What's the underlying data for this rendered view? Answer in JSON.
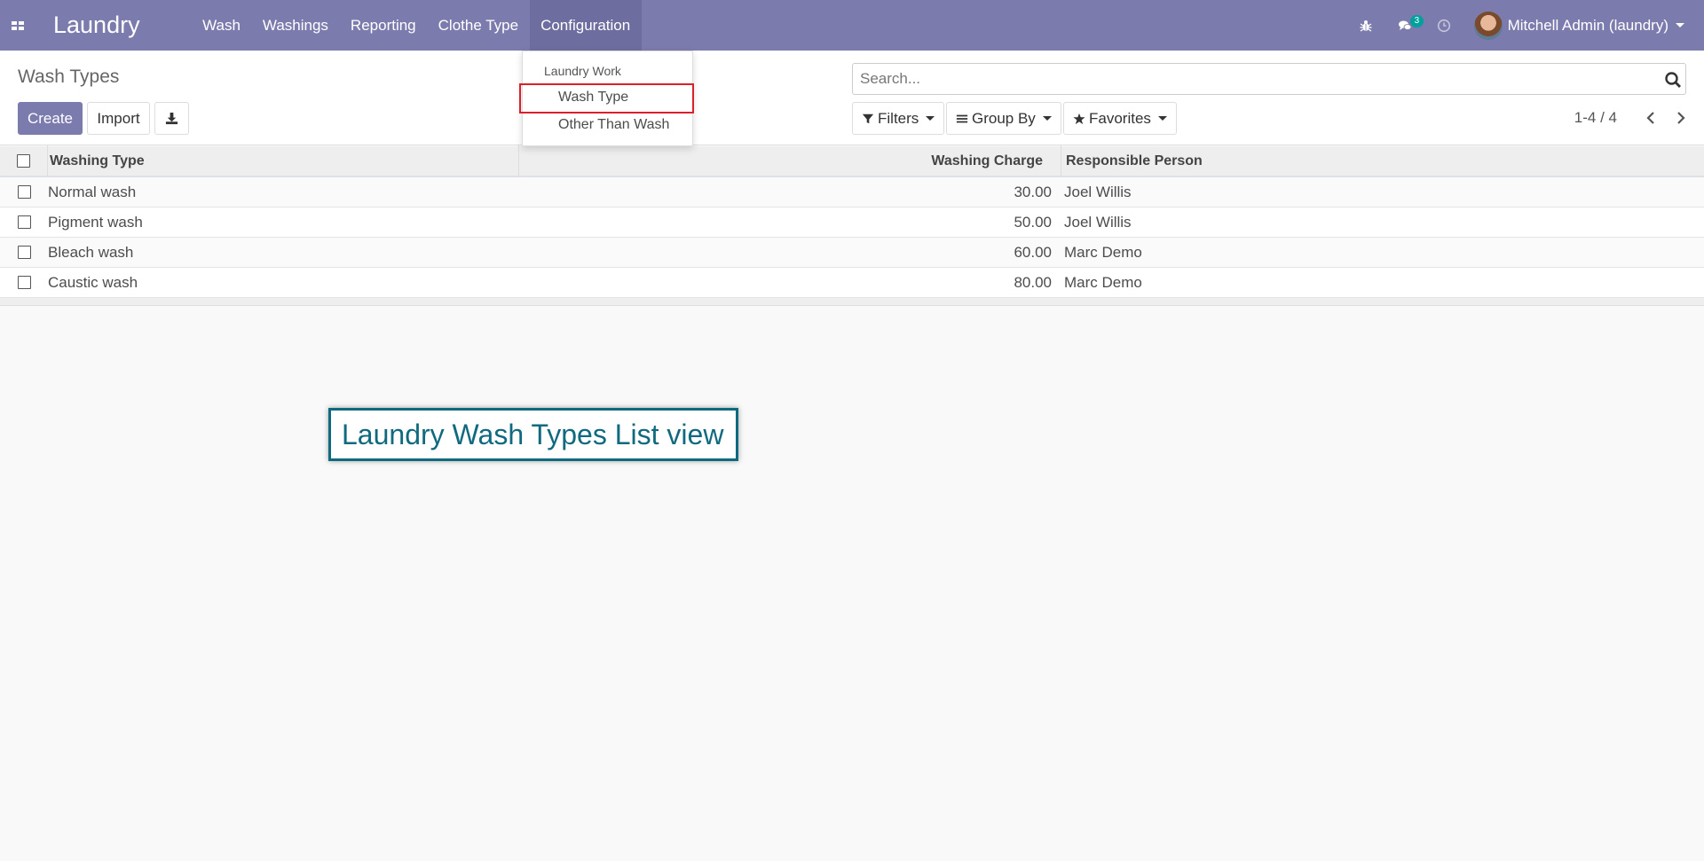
{
  "navbar": {
    "brand": "Laundry",
    "menu": [
      "Wash",
      "Washings",
      "Reporting",
      "Clothe Type",
      "Configuration"
    ],
    "chat_badge": "3",
    "user_name": "Mitchell Admin (laundry)"
  },
  "dropdown": {
    "header": "Laundry Work",
    "items": [
      "Wash Type",
      "Other Than Wash"
    ]
  },
  "control": {
    "breadcrumb": "Wash Types",
    "create_label": "Create",
    "import_label": "Import",
    "search_placeholder": "Search...",
    "filters_label": "Filters",
    "groupby_label": "Group By",
    "favorites_label": "Favorites",
    "pager": "1-4 / 4"
  },
  "table": {
    "headers": [
      "Washing Type",
      "Washing Charge",
      "Responsible Person"
    ],
    "rows": [
      {
        "type": "Normal wash",
        "charge": "30.00",
        "person": "Joel Willis"
      },
      {
        "type": "Pigment wash",
        "charge": "50.00",
        "person": "Joel Willis"
      },
      {
        "type": "Bleach wash",
        "charge": "60.00",
        "person": "Marc Demo"
      },
      {
        "type": "Caustic wash",
        "charge": "80.00",
        "person": "Marc Demo"
      }
    ]
  },
  "annotation": "Laundry Wash Types List view",
  "colors": {
    "brand": "#7c7bad",
    "badge": "#00a09d",
    "highlight": "#d9212c",
    "annotation": "#106a7f"
  }
}
